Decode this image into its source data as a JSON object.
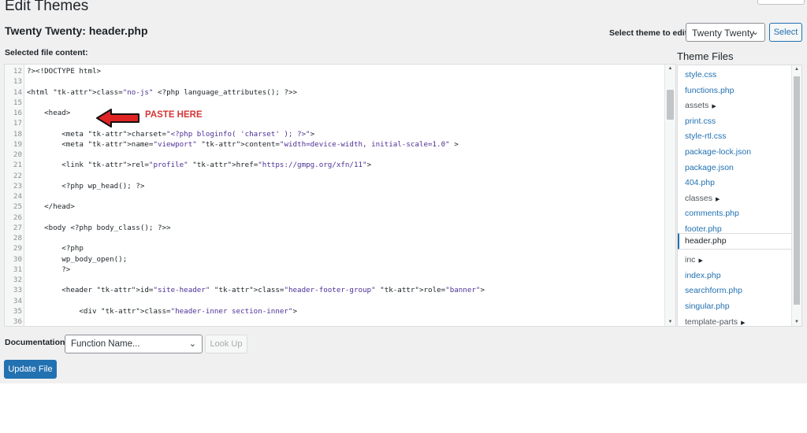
{
  "page": {
    "title": "Edit Themes",
    "file_heading": "Twenty Twenty: header.php"
  },
  "theme_selector": {
    "label": "Select theme to edit:",
    "selected": "Twenty Twenty",
    "button": "Select"
  },
  "editor": {
    "label": "Selected file content:",
    "lines": [
      {
        "n": "12",
        "c": "?><!DOCTYPE html>"
      },
      {
        "n": "13",
        "c": ""
      },
      {
        "n": "14",
        "c": "<html class=\"no-js\" <?php language_attributes(); ?>>"
      },
      {
        "n": "15",
        "c": ""
      },
      {
        "n": "16",
        "c": "    <head>"
      },
      {
        "n": "17",
        "c": ""
      },
      {
        "n": "18",
        "c": "        <meta charset=\"<?php bloginfo( 'charset' ); ?>\">"
      },
      {
        "n": "19",
        "c": "        <meta name=\"viewport\" content=\"width=device-width, initial-scale=1.0\" >"
      },
      {
        "n": "20",
        "c": ""
      },
      {
        "n": "21",
        "c": "        <link rel=\"profile\" href=\"https://gmpg.org/xfn/11\">"
      },
      {
        "n": "22",
        "c": ""
      },
      {
        "n": "23",
        "c": "        <?php wp_head(); ?>"
      },
      {
        "n": "24",
        "c": ""
      },
      {
        "n": "25",
        "c": "    </head>"
      },
      {
        "n": "26",
        "c": ""
      },
      {
        "n": "27",
        "c": "    <body <?php body_class(); ?>>"
      },
      {
        "n": "28",
        "c": ""
      },
      {
        "n": "29",
        "c": "        <?php"
      },
      {
        "n": "30",
        "c": "        wp_body_open();"
      },
      {
        "n": "31",
        "c": "        ?>"
      },
      {
        "n": "32",
        "c": ""
      },
      {
        "n": "33",
        "c": "        <header id=\"site-header\" class=\"header-footer-group\" role=\"banner\">"
      },
      {
        "n": "34",
        "c": ""
      },
      {
        "n": "35",
        "c": "            <div class=\"header-inner section-inner\">"
      },
      {
        "n": "36",
        "c": ""
      }
    ]
  },
  "annotation": {
    "text": "PASTE HERE",
    "color": "#d63638"
  },
  "theme_files": {
    "title": "Theme Files",
    "items": [
      {
        "label": "style.css",
        "type": "file"
      },
      {
        "label": "functions.php",
        "type": "file"
      },
      {
        "label": "assets",
        "type": "folder"
      },
      {
        "label": "print.css",
        "type": "file"
      },
      {
        "label": "style-rtl.css",
        "type": "file"
      },
      {
        "label": "package-lock.json",
        "type": "file"
      },
      {
        "label": "package.json",
        "type": "file"
      },
      {
        "label": "404.php",
        "type": "file"
      },
      {
        "label": "classes",
        "type": "folder"
      },
      {
        "label": "comments.php",
        "type": "file"
      },
      {
        "label": "footer.php",
        "type": "file"
      },
      {
        "label": "header.php",
        "type": "file",
        "active": true
      },
      {
        "label": "inc",
        "type": "folder"
      },
      {
        "label": "index.php",
        "type": "file"
      },
      {
        "label": "searchform.php",
        "type": "file"
      },
      {
        "label": "singular.php",
        "type": "file"
      },
      {
        "label": "template-parts",
        "type": "folder"
      }
    ]
  },
  "documentation": {
    "label": "Documentation:",
    "placeholder": "Function Name...",
    "lookup_button": "Look Up"
  },
  "update_button": "Update File",
  "colors": {
    "primary": "#2271b1",
    "background": "#f0f0f1",
    "annotation_red": "#d63638"
  },
  "icons": {
    "caret": "caret-right-icon",
    "chevron": "chevron-down-icon",
    "arrow": "red-arrow-left-icon"
  }
}
